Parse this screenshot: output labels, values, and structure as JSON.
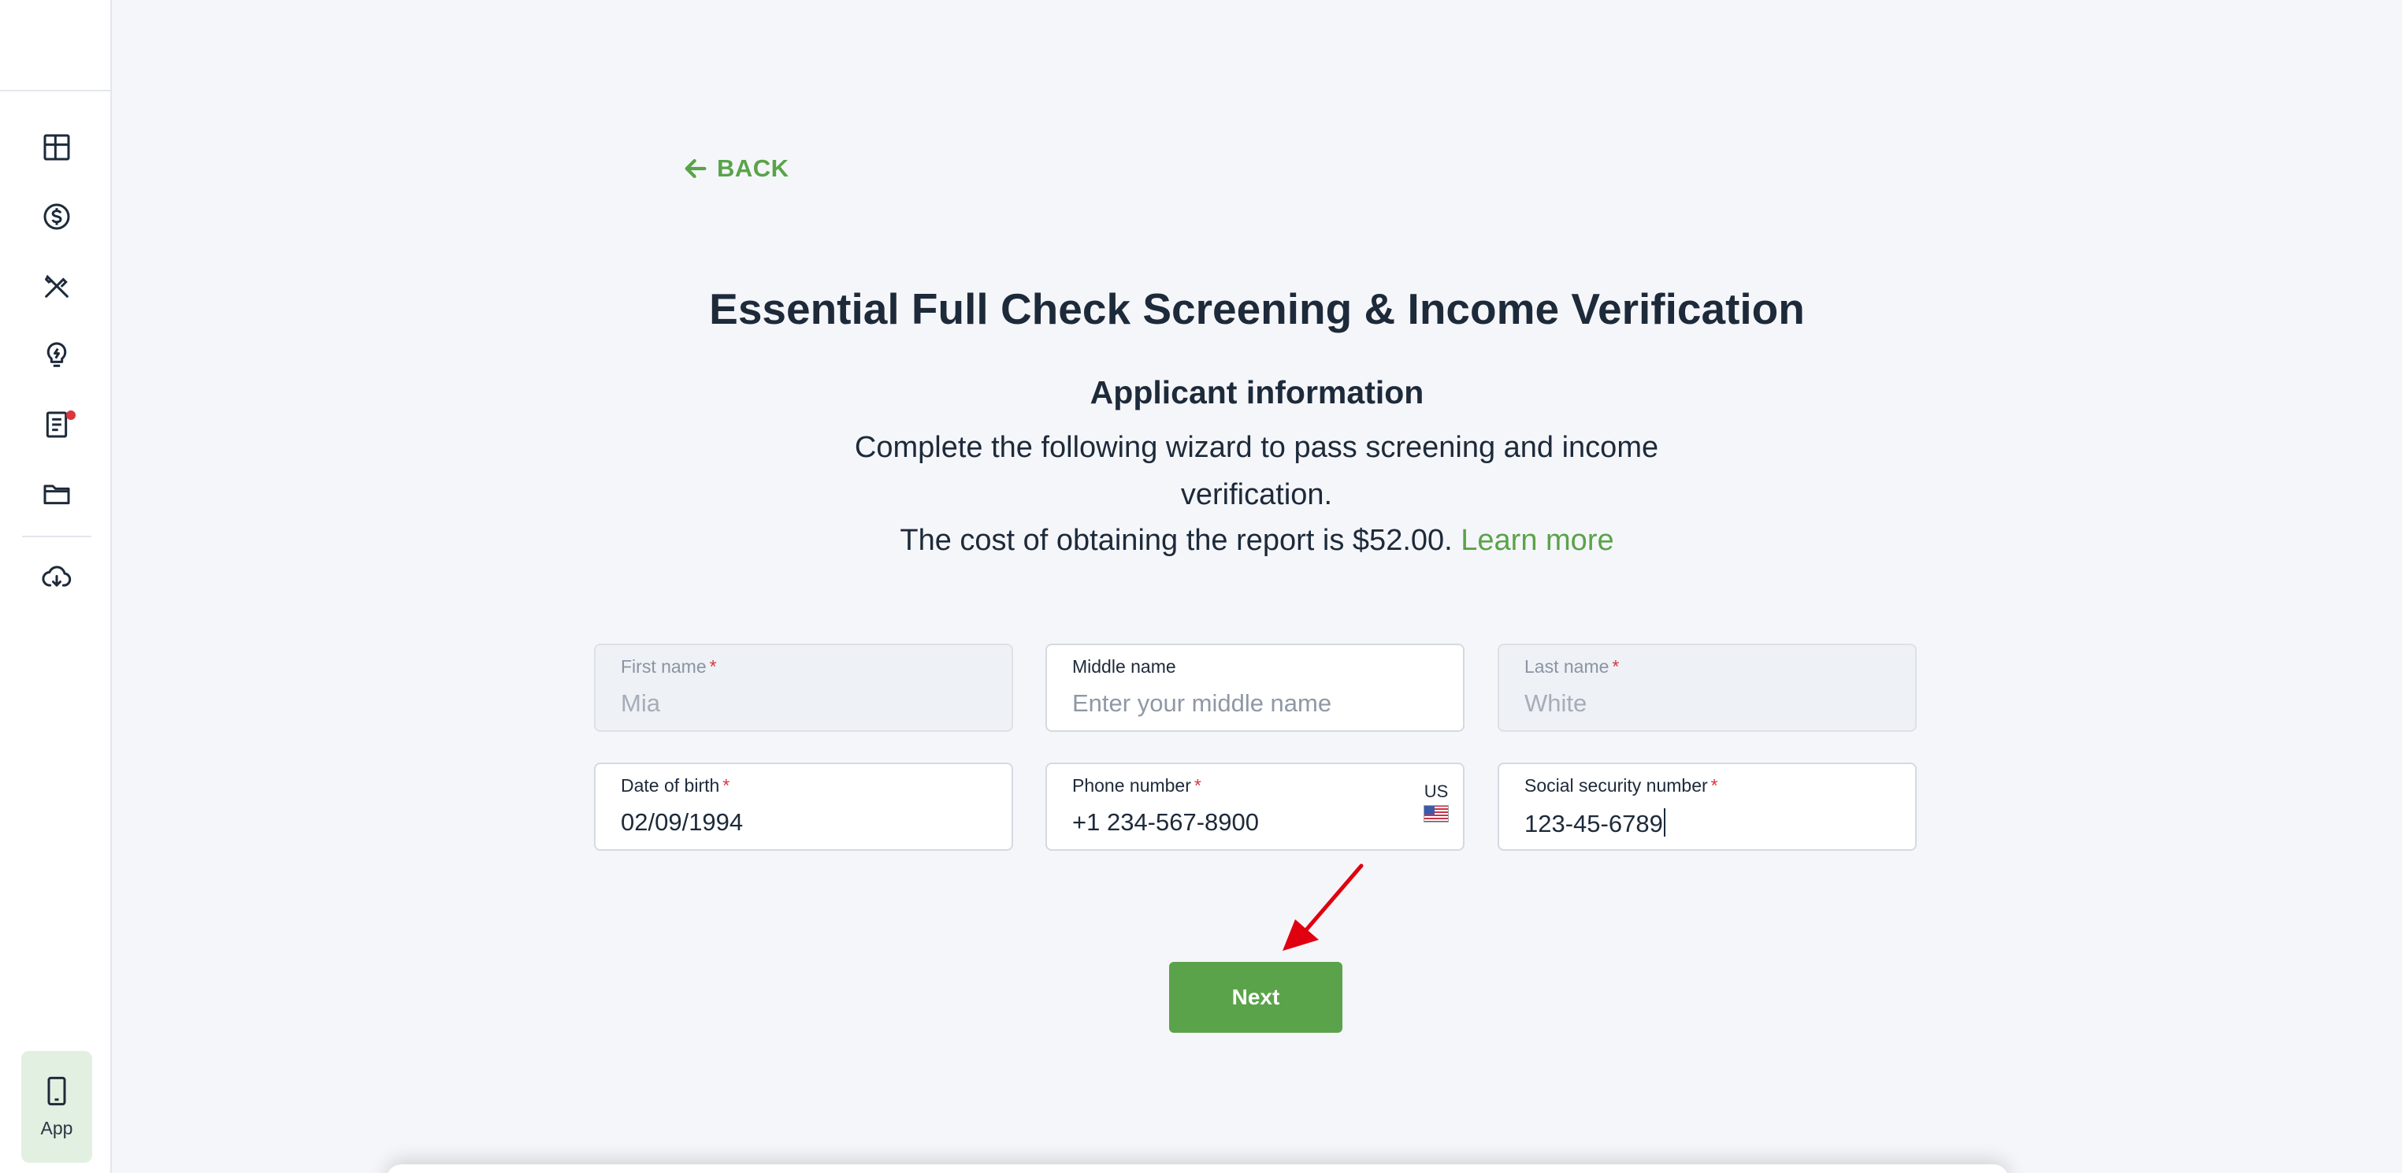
{
  "sidebar": {
    "items": [
      {
        "name": "dashboard-icon"
      },
      {
        "name": "payments-icon"
      },
      {
        "name": "maintenance-icon"
      },
      {
        "name": "insights-icon"
      },
      {
        "name": "documents-icon",
        "badge": true
      },
      {
        "name": "folder-icon"
      },
      {
        "name": "download-icon"
      }
    ],
    "app_button": {
      "label": "App",
      "icon": "mobile-phone-icon"
    }
  },
  "main": {
    "back_label": "BACK",
    "title": "Essential Full Check Screening & Income Verification",
    "subtitle": "Applicant information",
    "description": "Complete the following wizard to pass screening and income verification.",
    "cost_text": "The cost of obtaining the report is $52.00.",
    "learn_more": "Learn more"
  },
  "form": {
    "first_name": {
      "label": "First name",
      "value": "Mia",
      "required": true,
      "disabled": true
    },
    "middle_name": {
      "label": "Middle name",
      "placeholder": "Enter your middle name",
      "required": false
    },
    "last_name": {
      "label": "Last name",
      "value": "White",
      "required": true,
      "disabled": true
    },
    "dob": {
      "label": "Date of birth",
      "value": "02/09/1994",
      "required": true
    },
    "phone": {
      "label": "Phone number",
      "value": "+1 234-567-8900",
      "required": true,
      "country": "US"
    },
    "ssn": {
      "label": "Social security number",
      "value": "123-45-6789",
      "required": true
    }
  },
  "next_label": "Next",
  "required_mark": "*",
  "colors": {
    "accent": "#5aa34a",
    "required": "#d9363e",
    "text": "#1d2a3a",
    "background": "#f5f6fa",
    "annotation": "#e0000f"
  }
}
